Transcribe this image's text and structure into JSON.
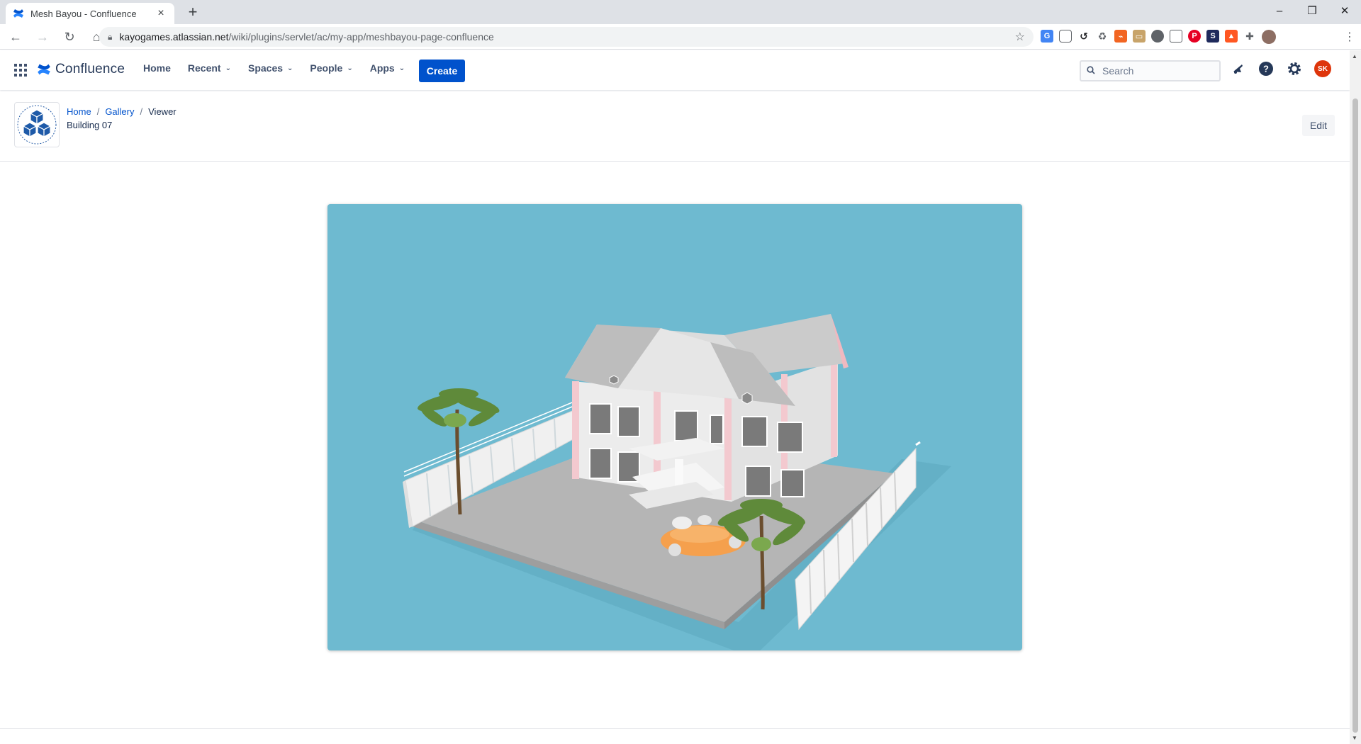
{
  "browser": {
    "tab_title": "Mesh Bayou - Confluence",
    "url_host": "kayogames.atlassian.net",
    "url_path": "/wiki/plugins/servlet/ac/my-app/meshbayou-page-confluence"
  },
  "header": {
    "logo_text": "Confluence",
    "nav": [
      {
        "label": "Home"
      },
      {
        "label": "Recent"
      },
      {
        "label": "Spaces"
      },
      {
        "label": "People"
      },
      {
        "label": "Apps"
      }
    ],
    "create_label": "Create",
    "search_placeholder": "Search",
    "user_initials": "SK"
  },
  "page": {
    "breadcrumbs": [
      "Home",
      "Gallery",
      "Viewer"
    ],
    "title": "Building 07",
    "edit_label": "Edit"
  },
  "colors": {
    "primary": "#0052cc",
    "viewer_bg": "#6ebad0",
    "avatar": "#de350b"
  }
}
